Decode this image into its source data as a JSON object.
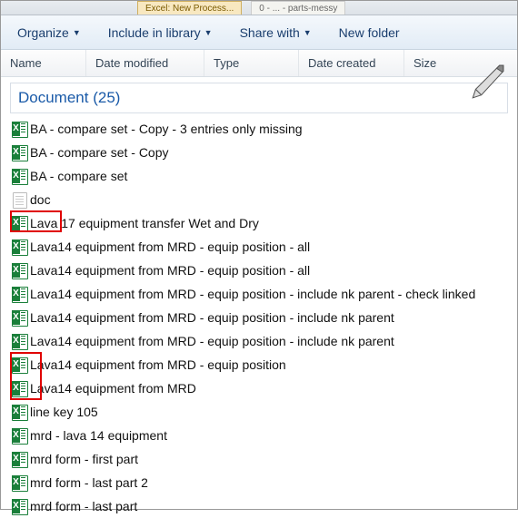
{
  "tabs": {
    "t0": "Excel: New Process...",
    "t1": "0 - ... - parts-messy"
  },
  "toolbar": {
    "organize": "Organize",
    "include": "Include in library",
    "share": "Share with",
    "newfolder": "New folder"
  },
  "headers": {
    "name": "Name",
    "date_modified": "Date modified",
    "type": "Type",
    "date_created": "Date created",
    "size": "Size"
  },
  "group": {
    "label": "Document (25)"
  },
  "files": [
    {
      "icon": "xls",
      "name": "BA - compare set - Copy - 3 entries only missing"
    },
    {
      "icon": "xls",
      "name": "BA - compare set - Copy"
    },
    {
      "icon": "xls",
      "name": "BA - compare set"
    },
    {
      "icon": "txt",
      "name": "doc"
    },
    {
      "icon": "xls",
      "name": "Lava 17 equipment transfer Wet and Dry"
    },
    {
      "icon": "xls",
      "name": "Lava14 equipment from MRD - equip position - all"
    },
    {
      "icon": "xls",
      "name": "Lava14 equipment from MRD - equip position - all"
    },
    {
      "icon": "xls",
      "name": "Lava14 equipment from MRD - equip position - include nk parent - check linked"
    },
    {
      "icon": "xls",
      "name": "Lava14 equipment from MRD - equip position - include nk parent"
    },
    {
      "icon": "xls",
      "name": "Lava14 equipment from MRD - equip position - include nk parent"
    },
    {
      "icon": "xls",
      "name": "Lava14 equipment from MRD - equip position"
    },
    {
      "icon": "xls",
      "name": "Lava14 equipment from MRD"
    },
    {
      "icon": "xls",
      "name": "line key 105"
    },
    {
      "icon": "xls",
      "name": "mrd - lava 14 equipment"
    },
    {
      "icon": "xls",
      "name": "mrd form - first part"
    },
    {
      "icon": "xls",
      "name": "mrd form - last part 2"
    },
    {
      "icon": "xls",
      "name": "mrd form - last part"
    }
  ]
}
